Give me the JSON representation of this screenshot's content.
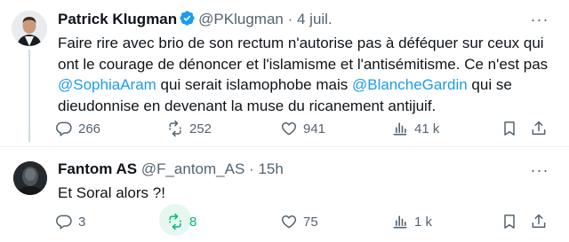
{
  "tweets": [
    {
      "author": "Patrick Klugman",
      "verified": true,
      "handle": "@PKlugman",
      "separator": "·",
      "time": "4 juil.",
      "more": "···",
      "text_parts": [
        "Faire rire avec brio de son rectum n'autorise pas à déféquer sur ceux qui ont le courage de dénoncer et l'islamisme et l'antisémitisme. Ce n'est  pas ",
        "@SophiaAram",
        " qui serait islamophobe mais ",
        "@BlancheGardin",
        " qui se dieudonnise en devenant la muse du ricanement antijuif."
      ],
      "replies": "266",
      "reposts": "252",
      "likes": "941",
      "views": "41 k"
    },
    {
      "author": "Fantom AS",
      "handle": "@F_antom_AS",
      "separator": "·",
      "time": "15h",
      "more": "···",
      "text": "Et Soral alors ?!",
      "replies": "3",
      "reposts": "8",
      "likes": "75",
      "views": "1 k"
    }
  ],
  "colors": {
    "accent": "#1d9bf0",
    "text": "#0f1419",
    "muted": "#536471",
    "repost_active": "#00ba7c"
  },
  "icons": [
    "reply-icon",
    "repost-icon",
    "like-icon",
    "views-icon",
    "bookmark-icon",
    "share-icon",
    "more-icon",
    "verified-icon"
  ]
}
